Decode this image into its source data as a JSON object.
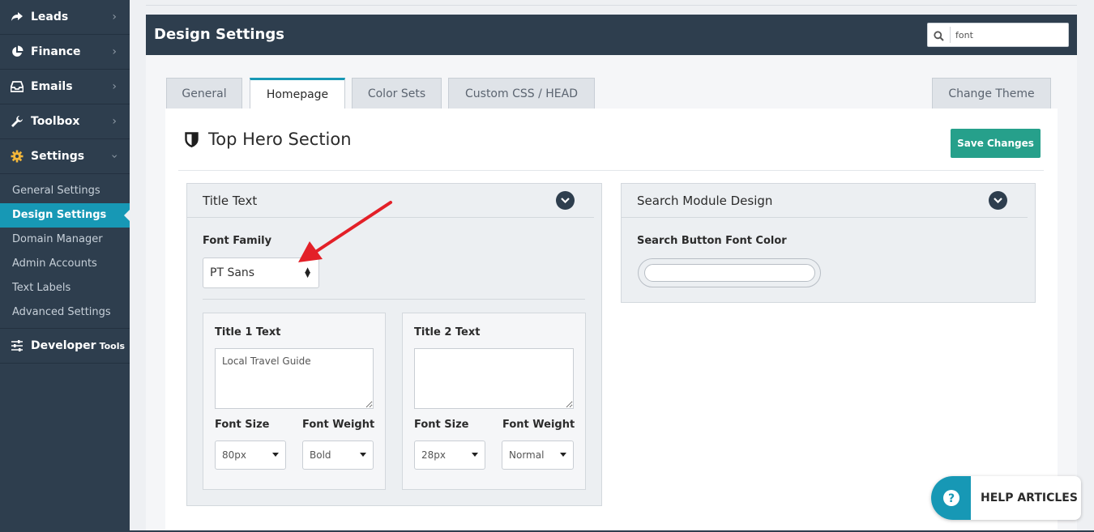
{
  "sidebar": {
    "items": [
      {
        "label": "Leads",
        "icon": "share-arrow-icon"
      },
      {
        "label": "Finance",
        "icon": "pie-chart-icon"
      },
      {
        "label": "Emails",
        "icon": "inbox-icon"
      },
      {
        "label": "Toolbox",
        "icon": "wrench-icon"
      },
      {
        "label": "Settings",
        "icon": "gear-icon"
      }
    ],
    "subitems": [
      {
        "label": "General Settings"
      },
      {
        "label": "Design Settings"
      },
      {
        "label": "Domain Manager"
      },
      {
        "label": "Admin Accounts"
      },
      {
        "label": "Text Labels"
      },
      {
        "label": "Advanced Settings"
      }
    ],
    "developer": {
      "label": "Developer",
      "suffix": "Tools"
    }
  },
  "header": {
    "title": "Design Settings",
    "search_value": "font"
  },
  "tabs": [
    {
      "label": "General"
    },
    {
      "label": "Homepage"
    },
    {
      "label": "Color Sets"
    },
    {
      "label": "Custom CSS / HEAD"
    }
  ],
  "change_theme_label": "Change Theme",
  "section": {
    "title": "Top Hero Section",
    "save_label": "Save Changes"
  },
  "title_text_card": {
    "heading": "Title Text",
    "font_family_label": "Font Family",
    "font_family_value": "PT Sans",
    "title1": {
      "label": "Title 1 Text",
      "value": "Local Travel Guide",
      "font_size_label": "Font Size",
      "font_size_value": "80px",
      "font_weight_label": "Font Weight",
      "font_weight_value": "Bold"
    },
    "title2": {
      "label": "Title 2 Text",
      "value": "",
      "font_size_label": "Font Size",
      "font_size_value": "28px",
      "font_weight_label": "Font Weight",
      "font_weight_value": "Normal"
    }
  },
  "search_card": {
    "heading": "Search Module Design",
    "button_font_color_label": "Search Button Font Color"
  },
  "help": {
    "label": "HELP ARTICLES"
  },
  "colors": {
    "sidebar_bg": "#2e3e4e",
    "accent": "#1798b5",
    "save_button": "#26a08b",
    "annotation_arrow": "#e32028"
  }
}
